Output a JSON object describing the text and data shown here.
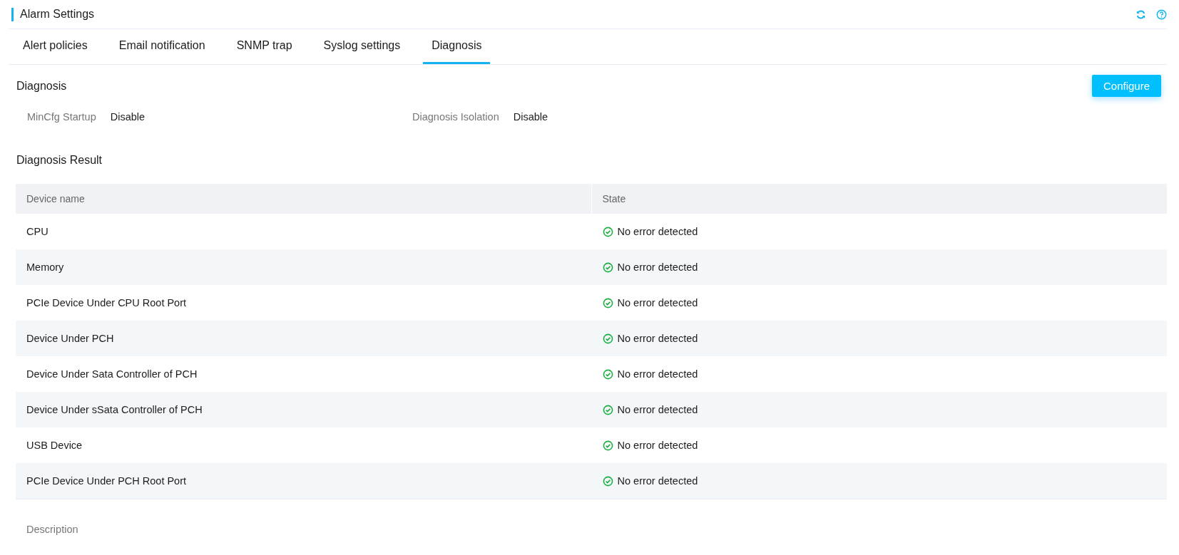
{
  "page": {
    "title": "Alarm Settings"
  },
  "tabs": [
    {
      "label": "Alert policies",
      "selected": false
    },
    {
      "label": "Email notification",
      "selected": false
    },
    {
      "label": "SNMP trap",
      "selected": false
    },
    {
      "label": "Syslog settings",
      "selected": false
    },
    {
      "label": "Diagnosis",
      "selected": true
    }
  ],
  "diagnosis": {
    "heading": "Diagnosis",
    "button": "Configure",
    "settings": [
      {
        "label": "MinCfg Startup",
        "value": "Disable"
      },
      {
        "label": "Diagnosis Isolation",
        "value": "Disable"
      }
    ]
  },
  "result": {
    "heading": "Diagnosis Result",
    "columns": [
      "Device name",
      "State"
    ],
    "rows": [
      {
        "device": "CPU",
        "state": "No error detected",
        "error": false
      },
      {
        "device": "Memory",
        "state": "No error detected",
        "error": false
      },
      {
        "device": "PCIe Device Under CPU Root Port",
        "state": "No error detected",
        "error": false
      },
      {
        "device": "Device Under PCH",
        "state": "No error detected",
        "error": false
      },
      {
        "device": "Device Under Sata Controller of PCH",
        "state": "No error detected",
        "error": false
      },
      {
        "device": "Device Under sSata Controller of PCH",
        "state": "No error detected",
        "error": false
      },
      {
        "device": "USB Device",
        "state": "No error detected",
        "error": false
      },
      {
        "device": "PCIe Device Under PCH Root Port",
        "state": "No error detected",
        "error": false
      }
    ]
  },
  "description": {
    "label": "Description"
  }
}
